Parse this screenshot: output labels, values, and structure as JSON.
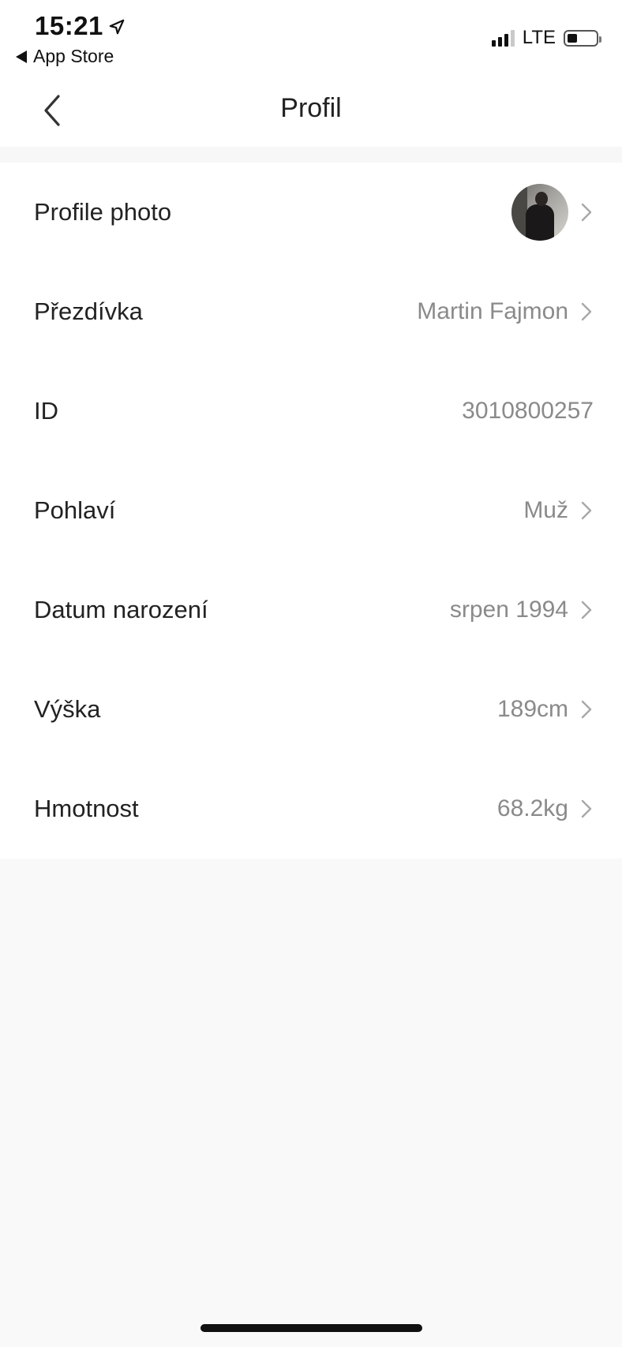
{
  "status_bar": {
    "time": "15:21",
    "back_app_label": "App Store",
    "network": "LTE"
  },
  "nav": {
    "title": "Profil"
  },
  "profile": {
    "rows": [
      {
        "label": "Profile photo",
        "value": ""
      },
      {
        "label": "Přezdívka",
        "value": "Martin Fajmon"
      },
      {
        "label": "ID",
        "value": "3010800257"
      },
      {
        "label": "Pohlaví",
        "value": "Muž"
      },
      {
        "label": "Datum narození",
        "value": "srpen 1994"
      },
      {
        "label": "Výška",
        "value": "189cm"
      },
      {
        "label": "Hmotnost",
        "value": "68.2kg"
      }
    ]
  },
  "icons": {
    "nav_back": "chevron-left-icon",
    "row_disclosure": "chevron-right-icon",
    "location": "location-arrow-icon",
    "signal": "cellular-signal-icon",
    "battery": "battery-icon"
  }
}
